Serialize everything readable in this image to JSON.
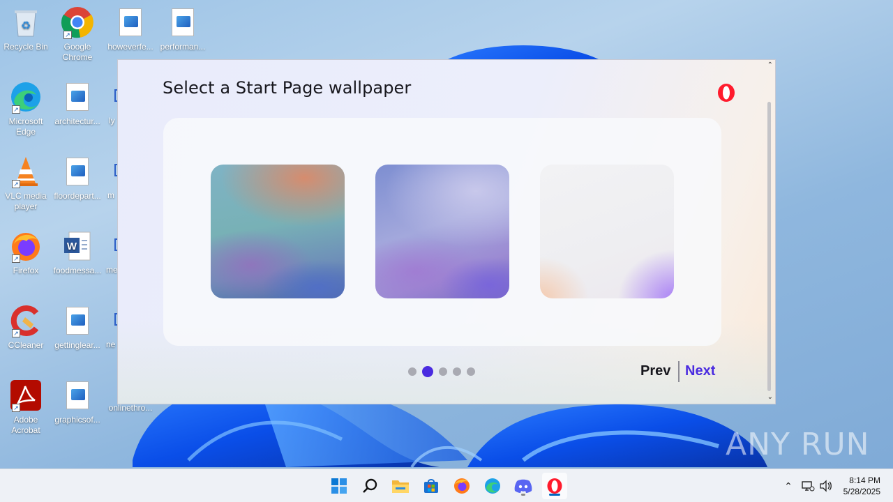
{
  "desktop": {
    "icons": [
      {
        "label": "Recycle Bin",
        "icon": "recycle-bin-icon"
      },
      {
        "label": "Google Chrome",
        "icon": "chrome-icon"
      },
      {
        "label": "howeverfe...",
        "icon": "image-file-icon"
      },
      {
        "label": "performan...",
        "icon": "image-file-icon"
      },
      {
        "label": "Microsoft Edge",
        "icon": "edge-icon"
      },
      {
        "label": "architectur...",
        "icon": "image-file-icon"
      },
      {
        "label": "VLC media player",
        "icon": "vlc-icon"
      },
      {
        "label": "floordepart...",
        "icon": "image-file-icon"
      },
      {
        "label": "Firefox",
        "icon": "firefox-icon"
      },
      {
        "label": "foodmessa...",
        "icon": "word-doc-icon"
      },
      {
        "label": "CCleaner",
        "icon": "ccleaner-icon"
      },
      {
        "label": "gettinglear...",
        "icon": "image-file-icon"
      },
      {
        "label": "Adobe Acrobat",
        "icon": "acrobat-icon"
      },
      {
        "label": "graphicsof...",
        "icon": "image-file-icon"
      },
      {
        "label": "onlinethro...",
        "icon": "image-file-icon"
      }
    ],
    "partial_labels": [
      "ly",
      "m",
      "me",
      "ne"
    ]
  },
  "dialog": {
    "title": "Select a Start Page wallpaper",
    "wallpapers": [
      "wallpaper-1",
      "wallpaper-2",
      "wallpaper-3"
    ],
    "pagination": {
      "total": 5,
      "active": 2
    },
    "prev_label": "Prev",
    "next_label": "Next",
    "accent_color": "#4a2be0"
  },
  "watermark": {
    "text": "ANY RUN"
  },
  "taskbar": {
    "apps": [
      "start-icon",
      "search-icon",
      "file-explorer-icon",
      "store-icon",
      "firefox-icon",
      "edge-icon",
      "discord-icon",
      "opera-icon"
    ],
    "clock": {
      "time": "8:14 PM",
      "date": "5/28/2025"
    }
  }
}
